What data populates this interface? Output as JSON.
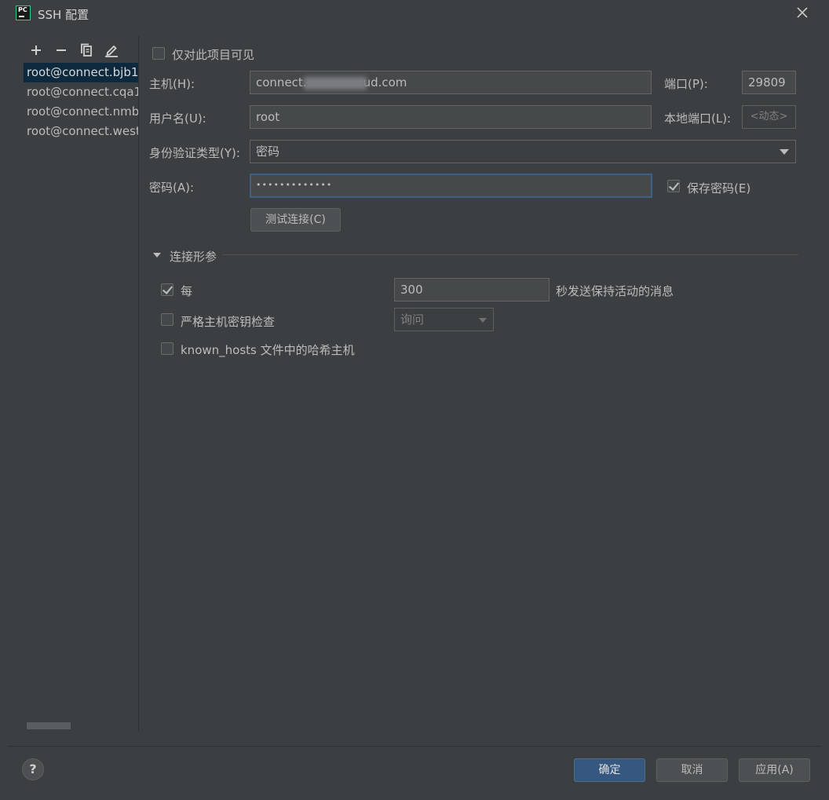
{
  "window": {
    "title": "SSH 配置",
    "app_icon_text": "PC"
  },
  "sidebar": {
    "toolbar": [
      "add-icon",
      "remove-icon",
      "copy-icon",
      "edit-icon"
    ],
    "hosts": [
      "root@connect.bjb1",
      "root@connect.cqa1",
      "root@connect.nmb",
      "root@connect.west"
    ],
    "selected_index": 0
  },
  "form": {
    "visible_only_project_label": "仅对此项目可见",
    "visible_only_project_checked": false,
    "host_label": "主机(H):",
    "host_value_prefix": "connect.",
    "host_value_suffix": "ud.com",
    "port_label": "端口(P):",
    "port_value": "29809",
    "username_label": "用户名(U):",
    "username_value": "root",
    "local_port_label": "本地端口(L):",
    "local_port_placeholder": "<动态>",
    "auth_type_label": "身份验证类型(Y):",
    "auth_type_value": "密码",
    "password_label": "密码(A):",
    "password_value": "•••••••••••••",
    "save_password_label": "保存密码(E)",
    "save_password_checked": true,
    "test_connection_label": "测试连接(C)"
  },
  "connection_params": {
    "section_title": "连接形参",
    "every_label": "每",
    "every_checked": true,
    "keepalive_value": "300",
    "keepalive_suffix": "秒发送保持活动的消息",
    "strict_host_key_label": "严格主机密钥检查",
    "strict_host_key_checked": false,
    "strict_host_key_value": "询问",
    "known_hosts_label": "known_hosts 文件中的哈希主机",
    "known_hosts_checked": false
  },
  "footer": {
    "help_label": "?",
    "ok_label": "确定",
    "cancel_label": "取消",
    "apply_label": "应用(A)"
  },
  "colors": {
    "background": "#3c3f41",
    "field": "#45494a",
    "selection": "#0d293e",
    "primary_button": "#365880",
    "focus_border": "#3d6185"
  }
}
